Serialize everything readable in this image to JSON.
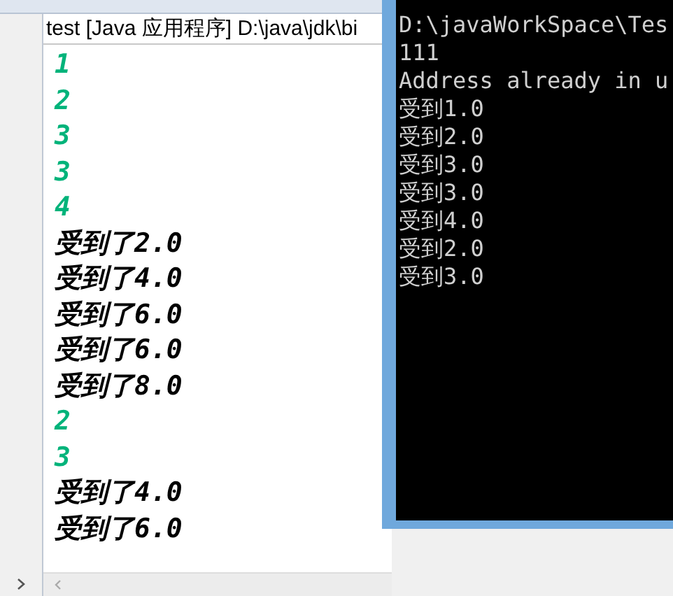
{
  "console": {
    "title": "test [Java 应用程序] D:\\java\\jdk\\bi",
    "lines": [
      {
        "text": "1",
        "color": "#00b37a"
      },
      {
        "text": "2",
        "color": "#00b37a"
      },
      {
        "text": "3",
        "color": "#00b37a"
      },
      {
        "text": "3",
        "color": "#00b37a"
      },
      {
        "text": "4",
        "color": "#00b37a"
      },
      {
        "text": "受到了2.0",
        "color": "#000000"
      },
      {
        "text": "受到了4.0",
        "color": "#000000"
      },
      {
        "text": "受到了6.0",
        "color": "#000000"
      },
      {
        "text": "受到了6.0",
        "color": "#000000"
      },
      {
        "text": "受到了8.0",
        "color": "#000000"
      },
      {
        "text": "2",
        "color": "#00b37a"
      },
      {
        "text": "3",
        "color": "#00b37a"
      },
      {
        "text": "受到了4.0",
        "color": "#000000"
      },
      {
        "text": "受到了6.0",
        "color": "#000000"
      }
    ]
  },
  "terminal": {
    "lines": [
      "D:\\javaWorkSpace\\Tes",
      "111",
      "Address already in u",
      "受到1.0",
      "受到2.0",
      "受到3.0",
      "受到3.0",
      "受到4.0",
      "受到2.0",
      "受到3.0"
    ]
  }
}
